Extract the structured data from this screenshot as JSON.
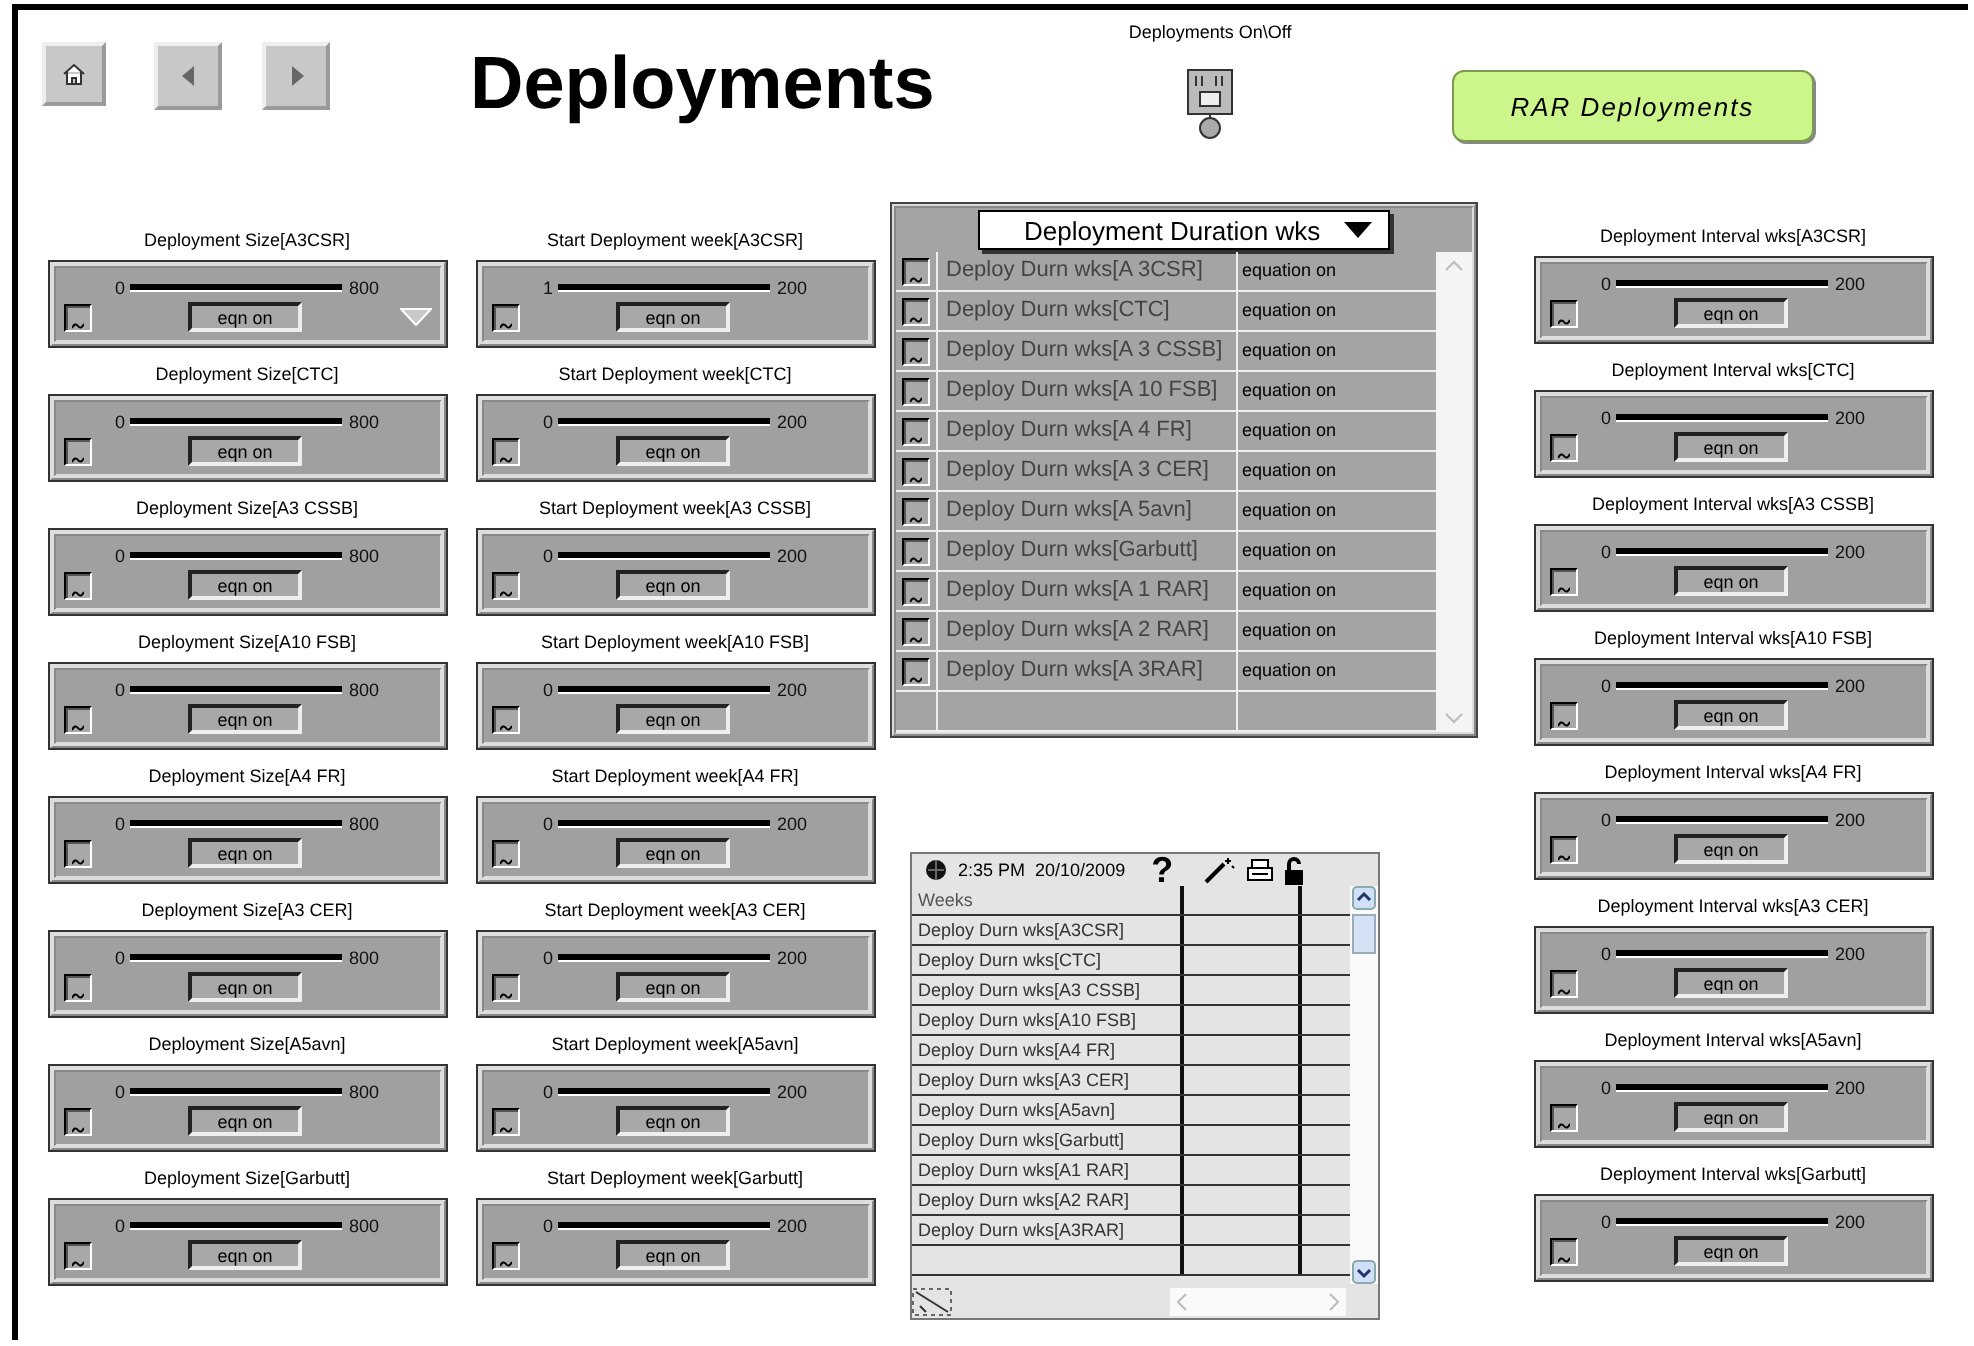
{
  "header": {
    "title": "Deployments",
    "switch_label": "Deployments On\\Off",
    "rar_button": "RAR Deployments"
  },
  "size_sliders": [
    {
      "label": "Deployment Size[A3CSR]",
      "min": "0",
      "max": "800",
      "button": "eqn on",
      "menu": true
    },
    {
      "label": "Deployment Size[CTC]",
      "min": "0",
      "max": "800",
      "button": "eqn on",
      "menu": false
    },
    {
      "label": "Deployment Size[A3 CSSB]",
      "min": "0",
      "max": "800",
      "button": "eqn on",
      "menu": false
    },
    {
      "label": "Deployment Size[A10 FSB]",
      "min": "0",
      "max": "800",
      "button": "eqn on",
      "menu": false
    },
    {
      "label": "Deployment Size[A4 FR]",
      "min": "0",
      "max": "800",
      "button": "eqn on",
      "menu": false
    },
    {
      "label": "Deployment Size[A3 CER]",
      "min": "0",
      "max": "800",
      "button": "eqn on",
      "menu": false
    },
    {
      "label": "Deployment Size[A5avn]",
      "min": "0",
      "max": "800",
      "button": "eqn on",
      "menu": false
    },
    {
      "label": "Deployment Size[Garbutt]",
      "min": "0",
      "max": "800",
      "button": "eqn on",
      "menu": false
    }
  ],
  "start_sliders": [
    {
      "label": "Start Deployment week[A3CSR]",
      "min": "1",
      "max": "200",
      "button": "eqn on",
      "menu": false
    },
    {
      "label": "Start Deployment week[CTC]",
      "min": "0",
      "max": "200",
      "button": "eqn on",
      "menu": false
    },
    {
      "label": "Start Deployment week[A3 CSSB]",
      "min": "0",
      "max": "200",
      "button": "eqn on",
      "menu": false
    },
    {
      "label": "Start Deployment week[A10 FSB]",
      "min": "0",
      "max": "200",
      "button": "eqn on",
      "menu": false
    },
    {
      "label": "Start Deployment week[A4 FR]",
      "min": "0",
      "max": "200",
      "button": "eqn on",
      "menu": false
    },
    {
      "label": "Start Deployment week[A3 CER]",
      "min": "0",
      "max": "200",
      "button": "eqn on",
      "menu": false
    },
    {
      "label": "Start Deployment week[A5avn]",
      "min": "0",
      "max": "200",
      "button": "eqn on",
      "menu": false
    },
    {
      "label": "Start Deployment week[Garbutt]",
      "min": "0",
      "max": "200",
      "button": "eqn on",
      "menu": false
    }
  ],
  "duration_panel": {
    "dropdown": "Deployment Duration wks",
    "rows": [
      {
        "name": "Deploy Durn wks[A 3CSR]",
        "status": "equation on"
      },
      {
        "name": "Deploy Durn wks[CTC]",
        "status": "equation on"
      },
      {
        "name": "Deploy Durn wks[A 3 CSSB]",
        "status": "equation on"
      },
      {
        "name": "Deploy Durn wks[A 10 FSB]",
        "status": "equation on"
      },
      {
        "name": "Deploy Durn wks[A 4 FR]",
        "status": "equation on"
      },
      {
        "name": "Deploy Durn wks[A 3 CER]",
        "status": "equation on"
      },
      {
        "name": "Deploy Durn wks[A 5avn]",
        "status": "equation on"
      },
      {
        "name": "Deploy Durn wks[Garbutt]",
        "status": "equation on"
      },
      {
        "name": "Deploy Durn wks[A 1 RAR]",
        "status": "equation on"
      },
      {
        "name": "Deploy Durn wks[A 2 RAR]",
        "status": "equation on"
      },
      {
        "name": "Deploy Durn wks[A 3RAR]",
        "status": "equation on"
      }
    ]
  },
  "table": {
    "time": "2:35 PM",
    "date": "20/10/2009",
    "help": "?",
    "header": "Weeks",
    "rows": [
      "Deploy Durn wks[A3CSR]",
      "Deploy Durn wks[CTC]",
      "Deploy Durn wks[A3 CSSB]",
      "Deploy Durn wks[A10 FSB]",
      "Deploy Durn wks[A4 FR]",
      "Deploy Durn wks[A3 CER]",
      "Deploy Durn wks[A5avn]",
      "Deploy Durn wks[Garbutt]",
      "Deploy Durn wks[A1 RAR]",
      "Deploy Durn wks[A2 RAR]",
      "Deploy Durn wks[A3RAR]"
    ]
  },
  "interval_sliders": [
    {
      "label": "Deployment Interval wks[A3CSR]",
      "min": "0",
      "max": "200",
      "button": "eqn on",
      "menu": false
    },
    {
      "label": "Deployment Interval wks[CTC]",
      "min": "0",
      "max": "200",
      "button": "eqn on",
      "menu": false
    },
    {
      "label": "Deployment Interval wks[A3 CSSB]",
      "min": "0",
      "max": "200",
      "button": "eqn on",
      "menu": false
    },
    {
      "label": "Deployment Interval wks[A10 FSB]",
      "min": "0",
      "max": "200",
      "button": "eqn on",
      "menu": false
    },
    {
      "label": "Deployment Interval wks[A4 FR]",
      "min": "0",
      "max": "200",
      "button": "eqn on",
      "menu": false
    },
    {
      "label": "Deployment Interval wks[A3 CER]",
      "min": "0",
      "max": "200",
      "button": "eqn on",
      "menu": false
    },
    {
      "label": "Deployment Interval wks[A5avn]",
      "min": "0",
      "max": "200",
      "button": "eqn on",
      "menu": false
    },
    {
      "label": "Deployment Interval wks[Garbutt]",
      "min": "0",
      "max": "200",
      "button": "eqn on",
      "menu": false
    }
  ]
}
